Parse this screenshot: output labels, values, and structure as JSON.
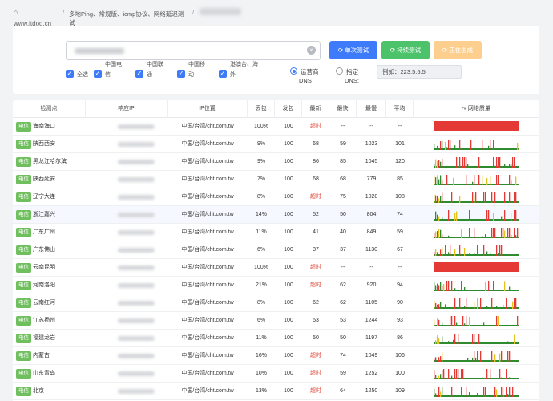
{
  "header": {
    "home_icon": "⌂",
    "site": "www.itdog.cn",
    "separator": "/",
    "breadcrumb": "多地Ping、常规版、icmp协议、网络延迟测试"
  },
  "form": {
    "clear_icon": "×",
    "btn_once": "单次测试",
    "btn_continuous": "持续测试",
    "btn_generating": "正在生成",
    "checkboxes": [
      {
        "top": "",
        "bottom": "全选"
      },
      {
        "top": "中国电",
        "bottom": "信"
      },
      {
        "top": "中国联",
        "bottom": "通"
      },
      {
        "top": "中国移",
        "bottom": "动"
      },
      {
        "top": "港澳台、海",
        "bottom": "外"
      }
    ],
    "check_mark": "✓",
    "dns_carrier_top": "运营商",
    "dns_carrier_bottom": "DNS",
    "dns_custom_top": "指定",
    "dns_custom_bottom": "DNS:",
    "dns_value": "例如：223.5.5.5"
  },
  "table": {
    "headers": [
      "检测点",
      "响应IP",
      "IP位置",
      "丢包",
      "发包",
      "最新",
      "最快",
      "最慢",
      "平均",
      "∿ 网络质量"
    ],
    "tag_label": "电信",
    "rows": [
      {
        "loc": "海南海口",
        "ip_loc": "中国/台湾/cht.com.tw",
        "loss": "100%",
        "sent": "100",
        "latest": "超时",
        "fast": "--",
        "slow": "--",
        "avg": "--",
        "q": 0
      },
      {
        "loc": "陕西西安",
        "ip_loc": "中国/台湾/cht.com.tw",
        "loss": "9%",
        "sent": "100",
        "latest": "68",
        "fast": "59",
        "slow": "1023",
        "avg": "101",
        "q": 1
      },
      {
        "loc": "黑龙江哈尔滨",
        "ip_loc": "中国/台湾/cht.com.tw",
        "loss": "9%",
        "sent": "100",
        "latest": "86",
        "fast": "85",
        "slow": "1045",
        "avg": "120",
        "q": 2
      },
      {
        "loc": "陕西延安",
        "ip_loc": "中国/台湾/cht.com.tw",
        "loss": "7%",
        "sent": "100",
        "latest": "68",
        "fast": "68",
        "slow": "779",
        "avg": "85",
        "q": 3
      },
      {
        "loc": "辽宁大连",
        "ip_loc": "中国/台湾/cht.com.tw",
        "loss": "8%",
        "sent": "100",
        "latest": "超时",
        "fast": "75",
        "slow": "1028",
        "avg": "108",
        "q": 4
      },
      {
        "loc": "浙江嘉兴",
        "ip_loc": "中国/台湾/cht.com.tw",
        "loss": "14%",
        "sent": "100",
        "latest": "52",
        "fast": "50",
        "slow": "804",
        "avg": "74",
        "q": 5
      },
      {
        "loc": "广东广州",
        "ip_loc": "中国/台湾/cht.com.tw",
        "loss": "11%",
        "sent": "100",
        "latest": "41",
        "fast": "40",
        "slow": "849",
        "avg": "59",
        "q": 6
      },
      {
        "loc": "广东佛山",
        "ip_loc": "中国/台湾/cht.com.tw",
        "loss": "6%",
        "sent": "100",
        "latest": "37",
        "fast": "37",
        "slow": "1130",
        "avg": "67",
        "q": 7
      },
      {
        "loc": "云南昆明",
        "ip_loc": "中国/台湾/cht.com.tw",
        "loss": "100%",
        "sent": "100",
        "latest": "超时",
        "fast": "--",
        "slow": "--",
        "avg": "--",
        "q": 0
      },
      {
        "loc": "河南洛阳",
        "ip_loc": "中国/台湾/cht.com.tw",
        "loss": "21%",
        "sent": "100",
        "latest": "超时",
        "fast": "62",
        "slow": "920",
        "avg": "94",
        "q": 8
      },
      {
        "loc": "云南红河",
        "ip_loc": "中国/台湾/cht.com.tw",
        "loss": "8%",
        "sent": "100",
        "latest": "62",
        "fast": "62",
        "slow": "1105",
        "avg": "90",
        "q": 9
      },
      {
        "loc": "江苏扬州",
        "ip_loc": "中国/台湾/cht.com.tw",
        "loss": "6%",
        "sent": "100",
        "latest": "53",
        "fast": "53",
        "slow": "1244",
        "avg": "93",
        "q": 10
      },
      {
        "loc": "福建龙岩",
        "ip_loc": "中国/台湾/cht.com.tw",
        "loss": "11%",
        "sent": "100",
        "latest": "50",
        "fast": "50",
        "slow": "1197",
        "avg": "86",
        "q": 11
      },
      {
        "loc": "内蒙古",
        "ip_loc": "中国/台湾/cht.com.tw",
        "loss": "16%",
        "sent": "100",
        "latest": "超时",
        "fast": "74",
        "slow": "1049",
        "avg": "106",
        "q": 12
      },
      {
        "loc": "山东青岛",
        "ip_loc": "中国/台湾/cht.com.tw",
        "loss": "10%",
        "sent": "100",
        "latest": "超时",
        "fast": "59",
        "slow": "1252",
        "avg": "100",
        "q": 13
      },
      {
        "loc": "北京",
        "ip_loc": "中国/台湾/cht.com.tw",
        "loss": "13%",
        "sent": "100",
        "latest": "超时",
        "fast": "64",
        "slow": "1250",
        "avg": "109",
        "q": 14
      }
    ]
  },
  "colors": {
    "ok": "#2e8b2e",
    "warn": "#e6c21c",
    "bad": "#e53935",
    "tag": "#6fbf5e",
    "primary": "#3e7bfa"
  }
}
